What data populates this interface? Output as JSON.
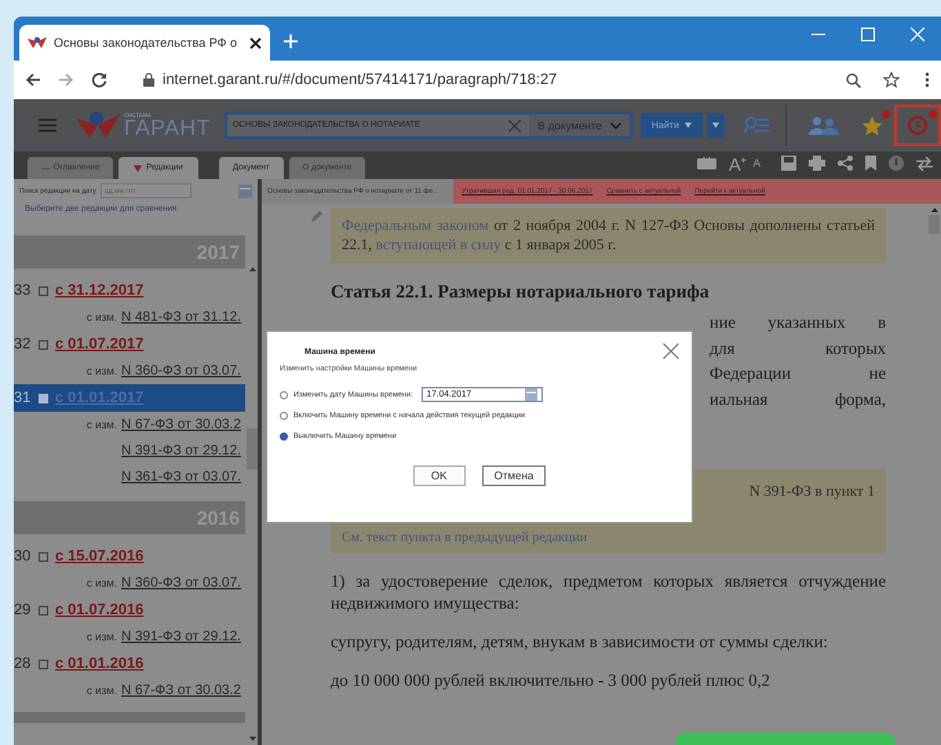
{
  "browser": {
    "tab_title": "Основы законодательства РФ о",
    "url": "internet.garant.ru/#/document/57414171/paragraph/718:27"
  },
  "header": {
    "logo_caption": "СИСТЕМА",
    "logo": "ГАРАНТ",
    "search_value": "ОСНОВЫ ЗАКОНОДАТЕЛЬСТВА О НОТАРИАТЕ",
    "scope": "В документе",
    "find_button": "Найти",
    "tools": [
      {
        "kind": "users",
        "badge": false,
        "highlighted": false
      },
      {
        "kind": "star",
        "badge": true,
        "highlighted": false
      },
      {
        "kind": "history",
        "badge": true,
        "highlighted": true
      }
    ]
  },
  "left_panel": {
    "tabs": [
      {
        "label": "Оглавление",
        "selected": false
      },
      {
        "label": "Редакции",
        "selected": true
      }
    ],
    "date_search": {
      "label": "Поиск редакции на дату",
      "placeholder": "дд.мм.гггг"
    },
    "compare_link": "Выберите две редакции для сравнения",
    "groups": [
      {
        "year": "2017",
        "editions": [
          {
            "number": "33",
            "checked": false,
            "selected": false,
            "date": "с 31.12.2017",
            "changes_label": "с изм.",
            "changes": [
              "N 481-ФЗ от 31.12."
            ]
          },
          {
            "number": "32",
            "checked": false,
            "selected": false,
            "date": "с 01.07.2017",
            "changes_label": "с изм.",
            "changes": [
              "N 360-ФЗ от 03.07."
            ]
          },
          {
            "number": "31",
            "checked": true,
            "selected": true,
            "date": "с 01.01.2017",
            "changes_label": "с изм.",
            "changes": [
              "N 67-ФЗ от 30.03.2",
              "N 391-ФЗ от 29.12.",
              "N 361-ФЗ от 03.07."
            ]
          }
        ]
      },
      {
        "year": "2016",
        "editions": [
          {
            "number": "30",
            "checked": false,
            "selected": false,
            "date": "с 15.07.2016",
            "changes_label": "с изм.",
            "changes": [
              "N 360-ФЗ от 03.07."
            ]
          },
          {
            "number": "29",
            "checked": false,
            "selected": false,
            "date": "с 01.07.2016",
            "changes_label": "с изм.",
            "changes": [
              "N 391-ФЗ от 29.12."
            ]
          },
          {
            "number": "28",
            "checked": false,
            "selected": false,
            "date": "с 01.01.2016",
            "changes_label": "с изм.",
            "changes": [
              "N 67-ФЗ от 30.03.2"
            ]
          }
        ]
      }
    ]
  },
  "doc_tabs": [
    {
      "label": "Документ",
      "selected": true
    },
    {
      "label": "О документе",
      "selected": false
    }
  ],
  "doc_toolbar": {
    "font_increase": "A⁺",
    "font_decrease": "A"
  },
  "info_bar": {
    "doc_title": "Основы законодательства РФ о нотариате от 11 фе...",
    "outdated": true,
    "status": "Утратившая ред. 01.01.2017 - 30.06.2017",
    "links": [
      "Сравнить с актуальной",
      "Перейти к актуальной"
    ]
  },
  "document": {
    "note": [
      {
        "text": "Федеральным законом",
        "kind": "link"
      },
      {
        "text": " от 2 ноября 2004 г. N 127-ФЗ Основы дополнены статьей 22.1, ",
        "kind": "text"
      },
      {
        "text": "вступающей в силу",
        "kind": "link"
      },
      {
        "text": " с 1 января 2005 г.",
        "kind": "text"
      }
    ],
    "heading": "Статья 22.1. Размеры нотариального тарифа",
    "covered_lines": [
      "ние указанных в",
      "для которых",
      "Федерации не",
      "иальная форма,"
    ],
    "change_note": {
      "text": "N 391-ФЗ в пункт 1",
      "link": "См. текст пункта в предыдущей редакции"
    },
    "paragraphs": [
      "1) за удостоверение сделок, предметом которых является отчуждение недвижимого имущества:",
      "супругу, родителям, детям, внукам в зависимости от суммы сделки:",
      "до 10 000 000 рублей включительно - 3 000 рублей плюс 0,2"
    ]
  },
  "dialog": {
    "title": "Машина времени",
    "subtitle": "Изменить настройки Машины времени",
    "options": [
      {
        "kind": "date",
        "label": "Изменить дату Машины времени:",
        "selected": false,
        "value": "17.04.2017"
      },
      {
        "kind": "plain",
        "label": "Включить Машину времени с начала действия текущей редакции",
        "selected": false
      },
      {
        "kind": "plain",
        "label": "Выключить Машину времени",
        "selected": true
      }
    ],
    "buttons": [
      "OK",
      "Отмена"
    ]
  }
}
